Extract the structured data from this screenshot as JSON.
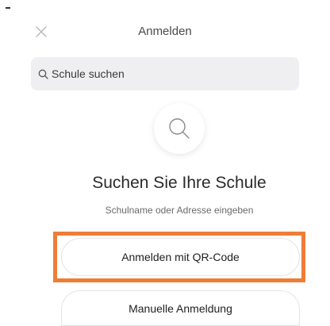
{
  "header": {
    "title": "Anmelden",
    "close_icon": "close-icon"
  },
  "search": {
    "placeholder": "Schule suchen",
    "icon": "search-icon"
  },
  "empty_state": {
    "icon": "search-icon",
    "heading": "Suchen Sie Ihre Schule",
    "subheading": "Schulname oder Adresse eingeben"
  },
  "actions": {
    "qr_label": "Anmelden mit QR-Code",
    "manual_label": "Manuelle Anmeldung"
  },
  "colors": {
    "highlight": "#ee7d36",
    "search_background": "#efeff1"
  }
}
